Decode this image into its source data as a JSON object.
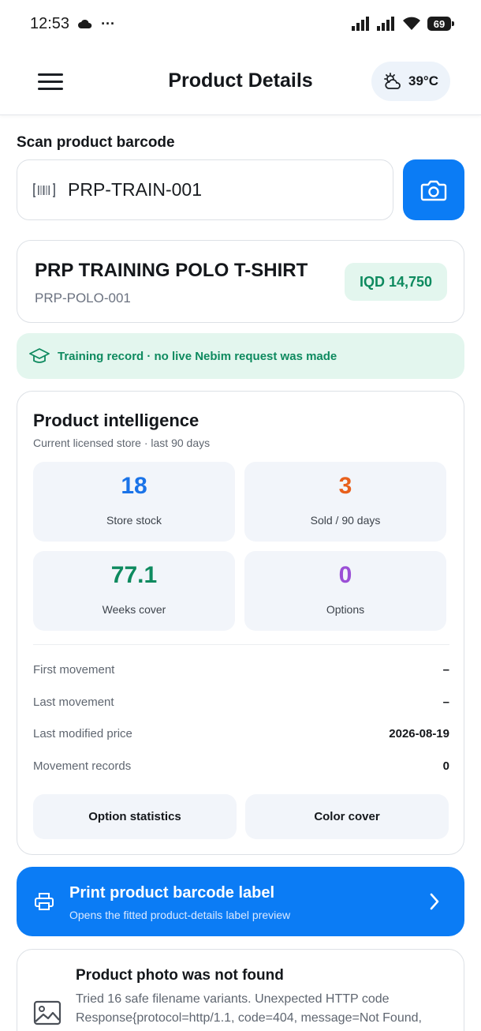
{
  "status_bar": {
    "time": "12:53",
    "dots": "···",
    "battery": "69"
  },
  "app_bar": {
    "title": "Product Details",
    "weather_temp": "39°C"
  },
  "scan": {
    "label": "Scan product barcode",
    "value": "PRP-TRAIN-001"
  },
  "product": {
    "name": "PRP TRAINING POLO T-SHIRT",
    "code": "PRP-POLO-001",
    "price": "IQD 14,750"
  },
  "notice": {
    "text": "Training record · no live Nebim request was made"
  },
  "intelligence": {
    "title": "Product intelligence",
    "subtitle": "Current licensed store · last 90 days",
    "stats": [
      {
        "value": "18",
        "label": "Store stock",
        "color": "#1a73e8"
      },
      {
        "value": "3",
        "label": "Sold / 90 days",
        "color": "#e8601c"
      },
      {
        "value": "77.1",
        "label": "Weeks cover",
        "color": "#0e8a5f"
      },
      {
        "value": "0",
        "label": "Options",
        "color": "#9b4fd6"
      }
    ],
    "rows": [
      {
        "label": "First movement",
        "value": "–"
      },
      {
        "label": "Last movement",
        "value": "–"
      },
      {
        "label": "Last modified price",
        "value": "2026-08-19"
      },
      {
        "label": "Movement records",
        "value": "0"
      }
    ],
    "buttons": {
      "option_statistics": "Option statistics",
      "color_cover": "Color cover"
    }
  },
  "print": {
    "title": "Print product barcode label",
    "subtitle": "Opens the fitted product-details label preview"
  },
  "photo": {
    "title": "Product photo was not found",
    "text": "Tried 16 safe filename variants. Unexpected HTTP code Response{protocol=http/1.1, code=404, message=Not Found,"
  },
  "colors": {
    "primary": "#0b7cf5",
    "success": "#0e8a5f",
    "success_bg": "#e3f6ee"
  }
}
